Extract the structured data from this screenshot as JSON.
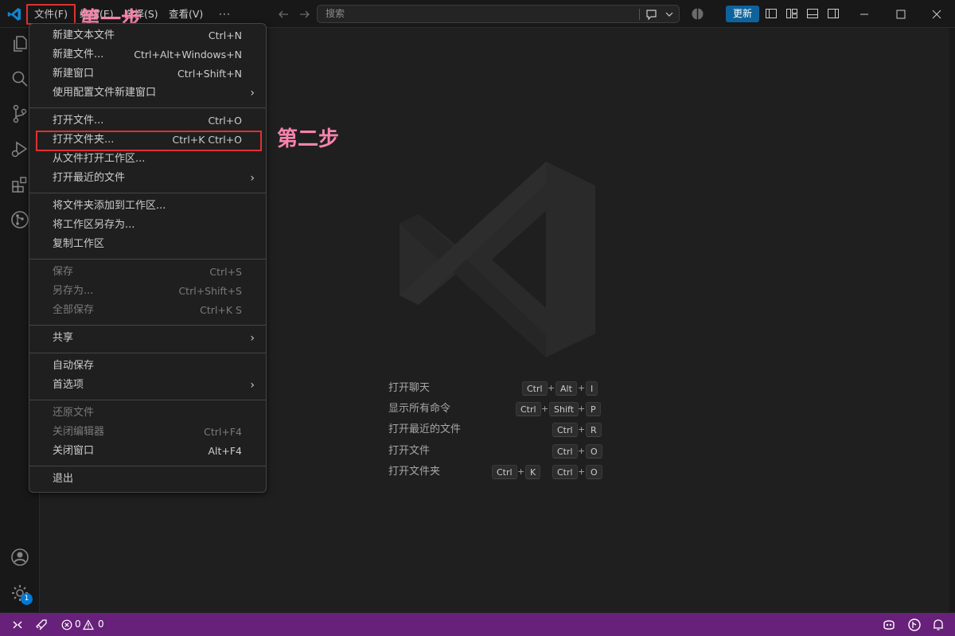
{
  "colors": {
    "accent": "#0078d4",
    "statusbar": "#68217a",
    "annotation": "#f783ac",
    "highlight_box": "#e03131"
  },
  "titlebar": {
    "menus": [
      "文件(F)",
      "编辑(E)",
      "选择(S)",
      "查看(V)",
      "···"
    ],
    "search_placeholder": "搜索",
    "update_label": "更新"
  },
  "annotations": {
    "step1": "第一步",
    "step2": "第二步"
  },
  "file_menu": {
    "groups": [
      [
        {
          "label": "新建文本文件",
          "key": "Ctrl+N"
        },
        {
          "label": "新建文件...",
          "key": "Ctrl+Alt+Windows+N"
        },
        {
          "label": "新建窗口",
          "key": "Ctrl+Shift+N"
        },
        {
          "label": "使用配置文件新建窗口",
          "key": ""
        }
      ],
      [
        {
          "label": "打开文件...",
          "key": "Ctrl+O"
        },
        {
          "label": "打开文件夹...",
          "key": "Ctrl+K Ctrl+O"
        },
        {
          "label": "从文件打开工作区...",
          "key": ""
        },
        {
          "label": "打开最近的文件",
          "key": ""
        }
      ],
      [
        {
          "label": "将文件夹添加到工作区...",
          "key": ""
        },
        {
          "label": "将工作区另存为...",
          "key": ""
        },
        {
          "label": "复制工作区",
          "key": ""
        }
      ],
      [
        {
          "label": "保存",
          "key": "Ctrl+S"
        },
        {
          "label": "另存为...",
          "key": "Ctrl+Shift+S"
        },
        {
          "label": "全部保存",
          "key": "Ctrl+K S"
        }
      ],
      [
        {
          "label": "共享",
          "key": ""
        }
      ],
      [
        {
          "label": "自动保存",
          "key": ""
        },
        {
          "label": "首选项",
          "key": ""
        }
      ],
      [
        {
          "label": "还原文件",
          "key": ""
        },
        {
          "label": "关闭编辑器",
          "key": "Ctrl+F4"
        },
        {
          "label": "关闭窗口",
          "key": "Alt+F4"
        }
      ],
      [
        {
          "label": "退出",
          "key": ""
        }
      ]
    ]
  },
  "welcome_shortcuts": [
    {
      "label": "打开聊天",
      "keys": [
        "Ctrl",
        "Alt",
        "I"
      ]
    },
    {
      "label": "显示所有命令",
      "keys": [
        "Ctrl",
        "Shift",
        "P"
      ]
    },
    {
      "label": "打开最近的文件",
      "keys": [
        "Ctrl",
        "R"
      ]
    },
    {
      "label": "打开文件",
      "keys": [
        "Ctrl",
        "O"
      ]
    },
    {
      "label": "打开文件夹",
      "keys": [
        "Ctrl",
        "K",
        "Ctrl",
        "O"
      ]
    }
  ],
  "activity_bar": {
    "icons": [
      "explorer-icon",
      "search-icon",
      "source-control-icon",
      "run-debug-icon",
      "extensions-icon",
      "git-graph-icon",
      "account-icon",
      "settings-gear-icon"
    ],
    "settings_badge": "1"
  },
  "statusbar": {
    "errors": "0",
    "warnings": "0"
  }
}
